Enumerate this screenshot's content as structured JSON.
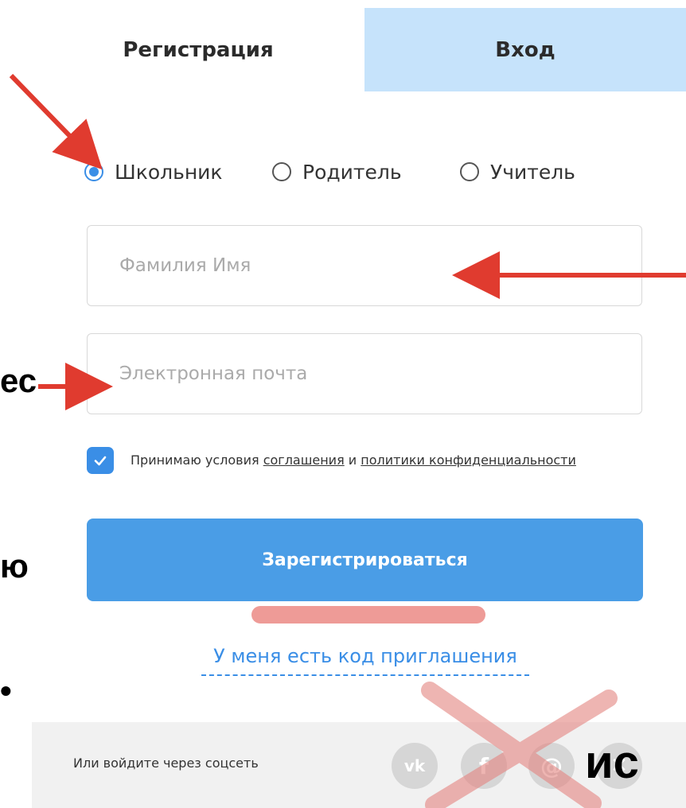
{
  "tabs": {
    "register": "Регистрация",
    "login": "Вход"
  },
  "roles": [
    {
      "label": "Школьник",
      "checked": true
    },
    {
      "label": "Родитель",
      "checked": false
    },
    {
      "label": "Учитель",
      "checked": false
    }
  ],
  "fields": {
    "name_placeholder": "Фамилия Имя",
    "email_placeholder": "Электронная почта"
  },
  "agreement": {
    "checked": true,
    "prefix": "Принимаю условия ",
    "link1": "соглашения",
    "middle": " и ",
    "link2": "политики конфиденциальности"
  },
  "register_button": "Зарегистрироваться",
  "invite_link": "У меня есть код приглашения",
  "social": {
    "label": "Или войдите через соцсеть",
    "icons": [
      "vk-icon",
      "facebook-icon",
      "mail-icon",
      "close-icon"
    ]
  },
  "overlay_fragments": [
    "ес",
    "ю",
    "•",
    "ис"
  ],
  "colors": {
    "accent": "#3a8ee6",
    "button": "#4a9de6",
    "login_tab": "#c6e3fb",
    "annotation_red": "#e03b2f",
    "social_bg": "#f1f1f1"
  }
}
